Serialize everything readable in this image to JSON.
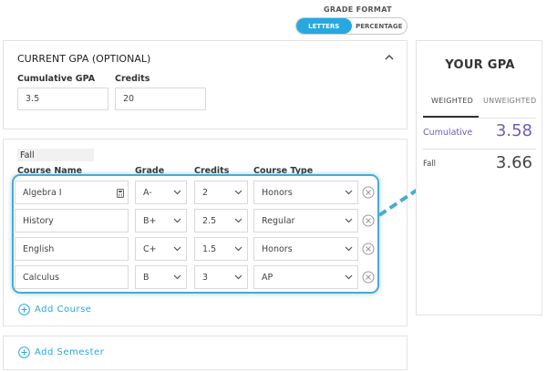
{
  "grade_format": {
    "label": "GRADE FORMAT",
    "options": [
      "LETTERS",
      "PERCENTAGE"
    ],
    "selected": "LETTERS"
  },
  "current_gpa": {
    "title": "CURRENT GPA (OPTIONAL)",
    "cumulative_label": "Cumulative GPA",
    "cumulative_value": "3.5",
    "credits_label": "Credits",
    "credits_value": "20"
  },
  "semester": {
    "name": "Fall",
    "headers": {
      "course_name": "Course Name",
      "grade": "Grade",
      "credits": "Credits",
      "course_type": "Course Type"
    },
    "courses": [
      {
        "name": "Algebra I",
        "grade": "A-",
        "credits": "2",
        "type": "Honors"
      },
      {
        "name": "History",
        "grade": "B+",
        "credits": "2.5",
        "type": "Regular"
      },
      {
        "name": "English",
        "grade": "C+",
        "credits": "1.5",
        "type": "Honors"
      },
      {
        "name": "Calculus",
        "grade": "B",
        "credits": "3",
        "type": "AP"
      }
    ],
    "add_course_label": "Add Course"
  },
  "add_semester_label": "Add Semester",
  "your_gpa": {
    "title": "YOUR GPA",
    "tabs": [
      "WEIGHTED",
      "UNWEIGHTED"
    ],
    "active_tab": "WEIGHTED",
    "cumulative_label": "Cumulative",
    "cumulative_value": "3.58",
    "semester_label": "Fall",
    "semester_value": "3.66"
  },
  "colors": {
    "accent": "#25a9e0",
    "cumulative_value": "#6b5fb5",
    "highlight": "#4aaad0"
  },
  "icons": {
    "collapse": "chevron-up-icon",
    "dropdown": "chevron-down-icon",
    "calculator": "calculator-icon",
    "remove": "close-circle-icon",
    "add": "plus-circle-icon"
  }
}
